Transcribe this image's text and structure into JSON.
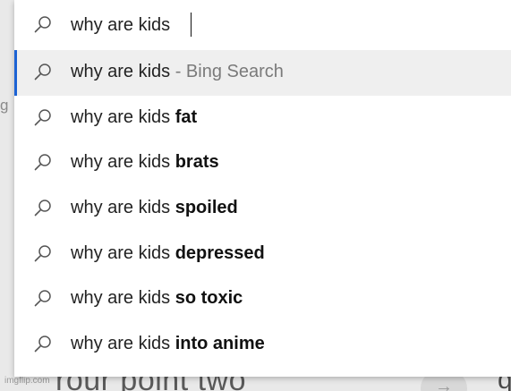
{
  "background": {
    "left_letter": "g",
    "bottom_text": "rour point two",
    "right_text": "qu",
    "arrow_icon": "→",
    "watermark": "imgflip.com"
  },
  "search": {
    "query": "why are kids "
  },
  "suggestions": [
    {
      "prefix": "why are kids",
      "suffix": "",
      "hint": " - Bing Search",
      "active": true
    },
    {
      "prefix": "why are kids ",
      "suffix": "fat",
      "hint": "",
      "active": false
    },
    {
      "prefix": "why are kids ",
      "suffix": "brats",
      "hint": "",
      "active": false
    },
    {
      "prefix": "why are kids ",
      "suffix": "spoiled",
      "hint": "",
      "active": false
    },
    {
      "prefix": "why are kids ",
      "suffix": "depressed",
      "hint": "",
      "active": false
    },
    {
      "prefix": "why are kids ",
      "suffix": "so toxic",
      "hint": "",
      "active": false
    },
    {
      "prefix": "why are kids ",
      "suffix": "into anime",
      "hint": "",
      "active": false
    }
  ],
  "colors": {
    "accent": "#1b62d4",
    "active_row": "#efefef",
    "hint_text": "#7a7a7a"
  },
  "icons": {
    "search": "search-icon"
  }
}
